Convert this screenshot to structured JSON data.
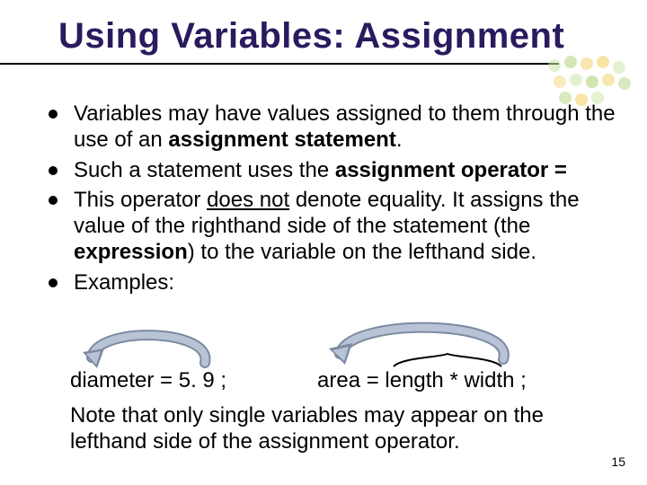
{
  "title": "Using Variables: Assignment",
  "bullets": [
    {
      "pre": "Variables may have values assigned to them through the use of an ",
      "bold": "assignment statement",
      "post": "."
    },
    {
      "pre": "Such a statement uses the ",
      "bold": "assignment operator  =",
      "post": ""
    },
    {
      "pre": "This operator ",
      "under": "does not",
      "mid": " denote equality.  It assigns the value of the righthand side of the statement (the ",
      "bold": "expression",
      "post": ") to the variable on the lefthand side."
    },
    {
      "pre": "Examples:",
      "bold": "",
      "post": ""
    }
  ],
  "examples": {
    "ex1": "diameter = 5. 9 ;",
    "ex2": "area = length * width ;"
  },
  "note": "Note that only single variables may appear on the lefthand side of the assignment operator.",
  "pageNumber": "15"
}
